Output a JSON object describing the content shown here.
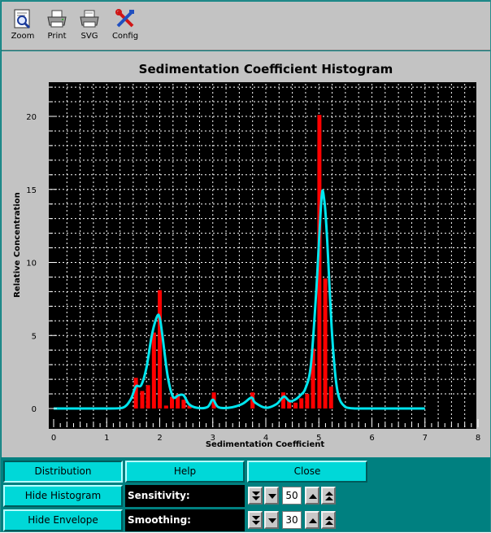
{
  "toolbar": {
    "items": [
      {
        "label": "Zoom",
        "icon": "zoom-icon"
      },
      {
        "label": "Print",
        "icon": "printer-icon"
      },
      {
        "label": "SVG",
        "icon": "svg-export-icon"
      },
      {
        "label": "Config",
        "icon": "config-tools-icon"
      }
    ]
  },
  "buttons": {
    "distribution": "Distribution",
    "help": "Help",
    "close": "Close",
    "hide_histogram": "Hide Histogram",
    "hide_envelope": "Hide Envelope"
  },
  "sensitivity": {
    "label": "Sensitivity:",
    "value": "50"
  },
  "smoothing": {
    "label": "Smoothing:",
    "value": "30"
  },
  "colors": {
    "plot_background": "#000000",
    "grid": "#ffffff",
    "bars": "#ff0000",
    "envelope": "#00e5ee",
    "frame": "#c3c3c3",
    "button": "#00d8d8",
    "window": "#008080"
  },
  "chart_data": {
    "type": "bar",
    "title": "Sedimentation Coefficient Histogram",
    "xlabel": "Sedimentation Coefficient",
    "ylabel": "Relative Concentration",
    "xlim": [
      0,
      8
    ],
    "ylim": [
      0,
      22.5
    ],
    "xticks": [
      "0",
      "1",
      "2",
      "3",
      "4",
      "5",
      "6",
      "7",
      "8"
    ],
    "yticks": [
      "0",
      "5",
      "10",
      "15",
      "20"
    ],
    "grid": true,
    "series": [
      {
        "kind": "histogram",
        "x": [
          1.55,
          1.67,
          1.78,
          1.89,
          2.0,
          2.12,
          2.23,
          2.34,
          2.45,
          2.56,
          3.02,
          3.75,
          4.33,
          4.44,
          4.56,
          4.67,
          4.78,
          4.89,
          5.01,
          5.12,
          5.23
        ],
        "values": [
          2.1,
          1.2,
          1.6,
          5.2,
          8.1,
          0.2,
          0.8,
          1.0,
          0.6,
          0.2,
          1.1,
          1.1,
          1.1,
          0.6,
          0.4,
          0.7,
          1.0,
          4.1,
          20.1,
          8.9,
          1.5
        ]
      },
      {
        "kind": "envelope",
        "x": [
          0.0,
          1.0,
          1.3,
          1.45,
          1.55,
          1.65,
          1.75,
          1.85,
          1.95,
          2.0,
          2.05,
          2.15,
          2.25,
          2.35,
          2.45,
          2.55,
          2.7,
          2.9,
          3.0,
          3.1,
          3.3,
          3.55,
          3.7,
          3.75,
          3.8,
          4.0,
          4.2,
          4.3,
          4.36,
          4.45,
          4.55,
          4.65,
          4.75,
          4.85,
          4.95,
          5.05,
          5.1,
          5.15,
          5.25,
          5.35,
          5.5,
          5.7,
          6.0,
          7.0
        ],
        "values": [
          0.0,
          0.0,
          0.05,
          0.6,
          1.5,
          1.6,
          2.8,
          5.0,
          6.3,
          6.2,
          5.0,
          2.2,
          0.8,
          0.9,
          0.9,
          0.3,
          0.05,
          0.1,
          0.6,
          0.1,
          0.05,
          0.3,
          0.7,
          0.7,
          0.4,
          0.05,
          0.3,
          0.7,
          0.8,
          0.5,
          0.6,
          0.9,
          1.4,
          3.0,
          8.0,
          14.4,
          14.3,
          12.0,
          5.0,
          1.2,
          0.1,
          0.0,
          0.0,
          0.0
        ]
      }
    ]
  }
}
